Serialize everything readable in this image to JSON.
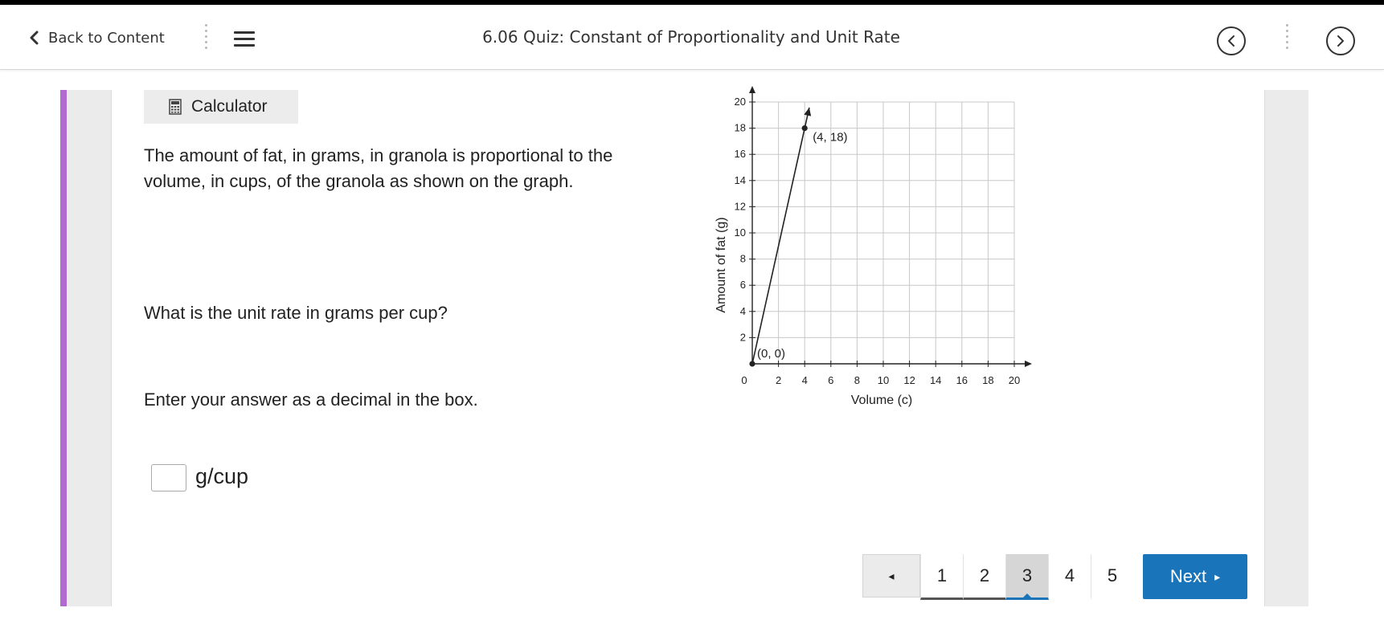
{
  "header": {
    "back_label": "Back to Content",
    "title": "6.06 Quiz: Constant of Proportionality and Unit Rate"
  },
  "calculator": {
    "label": "Calculator"
  },
  "question": {
    "line1": "The amount of fat, in grams, in granola is proportional to the",
    "line2": "volume, in cups, of the granola as shown on the graph.",
    "prompt": "What is the unit rate in grams per cup?",
    "instruction": "Enter your answer as a decimal in the box.",
    "answer_value": "",
    "unit": "g/cup"
  },
  "chart_data": {
    "type": "line",
    "xlabel": "Volume (c)",
    "ylabel": "Amount of fat (g)",
    "xlim": [
      0,
      20
    ],
    "ylim": [
      0,
      20
    ],
    "x_ticks": [
      "0",
      "2",
      "4",
      "6",
      "8",
      "10",
      "12",
      "14",
      "16",
      "18",
      "20"
    ],
    "y_ticks": [
      "2",
      "4",
      "6",
      "8",
      "10",
      "12",
      "14",
      "16",
      "18",
      "20"
    ],
    "grid": true,
    "series": [
      {
        "x": [
          0,
          4
        ],
        "y": [
          0,
          18
        ]
      }
    ],
    "annotations": [
      {
        "x": 0,
        "y": 0,
        "text": "(0, 0)"
      },
      {
        "x": 4,
        "y": 18,
        "text": "(4, 18)"
      }
    ]
  },
  "pagination": {
    "prev_symbol": "◂",
    "pages": [
      "1",
      "2",
      "3",
      "4",
      "5"
    ],
    "current": "3",
    "next_label": "Next",
    "next_symbol": "▸"
  },
  "colors": {
    "accent": "#b26ad3",
    "primary": "#1a74b9"
  }
}
